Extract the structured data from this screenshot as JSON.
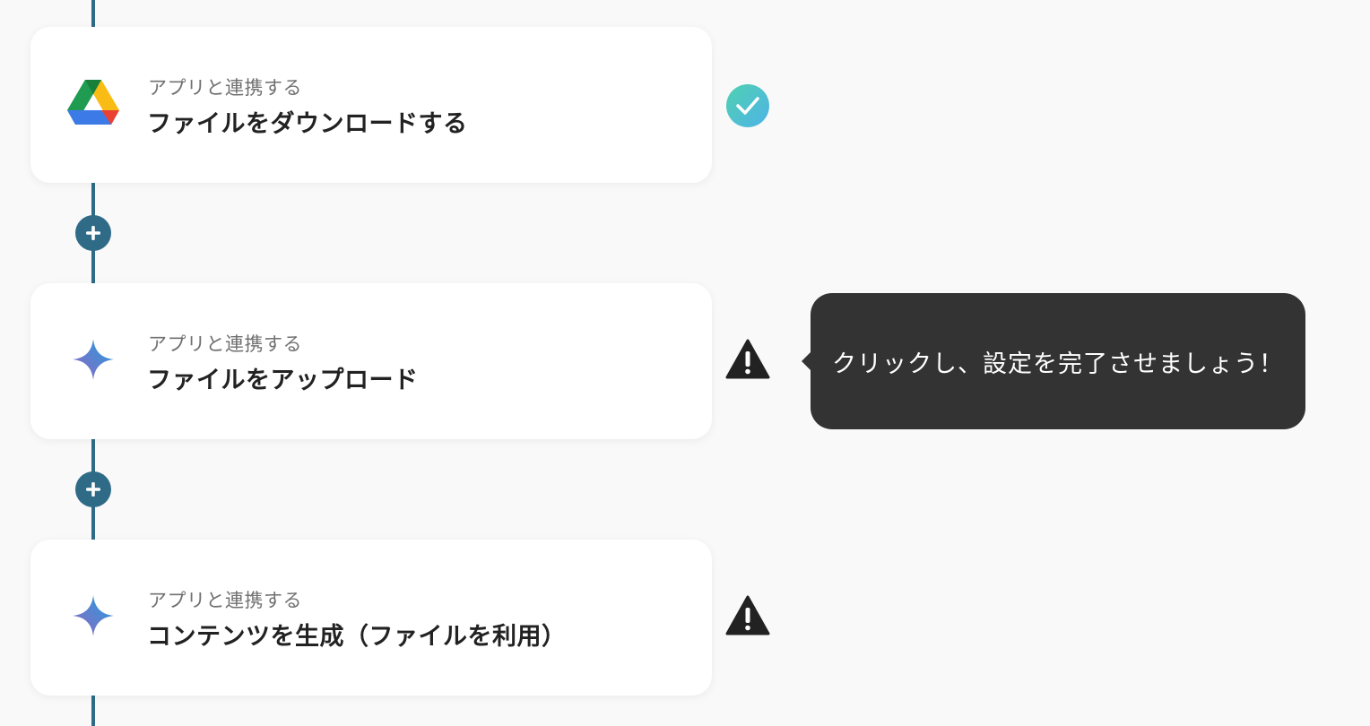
{
  "steps": [
    {
      "subtitle": "アプリと連携する",
      "title": "ファイルをダウンロードする",
      "app_icon": "google-drive-icon",
      "status": "complete",
      "status_icon": "check-circle-icon"
    },
    {
      "subtitle": "アプリと連携する",
      "title": "ファイルをアップロード",
      "app_icon": "gemini-sparkle-icon",
      "status": "warning",
      "status_icon": "warning-triangle-icon"
    },
    {
      "subtitle": "アプリと連携する",
      "title": "コンテンツを生成（ファイルを利用）",
      "app_icon": "gemini-sparkle-icon",
      "status": "warning",
      "status_icon": "warning-triangle-icon"
    }
  ],
  "add_step_icon": "plus-icon",
  "tooltip": {
    "text": "クリックし、設定を完了させましょう！"
  },
  "colors": {
    "flow_line": "#2f6b87",
    "background": "#f9f9f9",
    "card": "#ffffff",
    "tooltip_bg": "#333333",
    "check_gradient_start": "#4fd1b0",
    "check_gradient_end": "#4fb3e8",
    "warning": "#222222"
  }
}
